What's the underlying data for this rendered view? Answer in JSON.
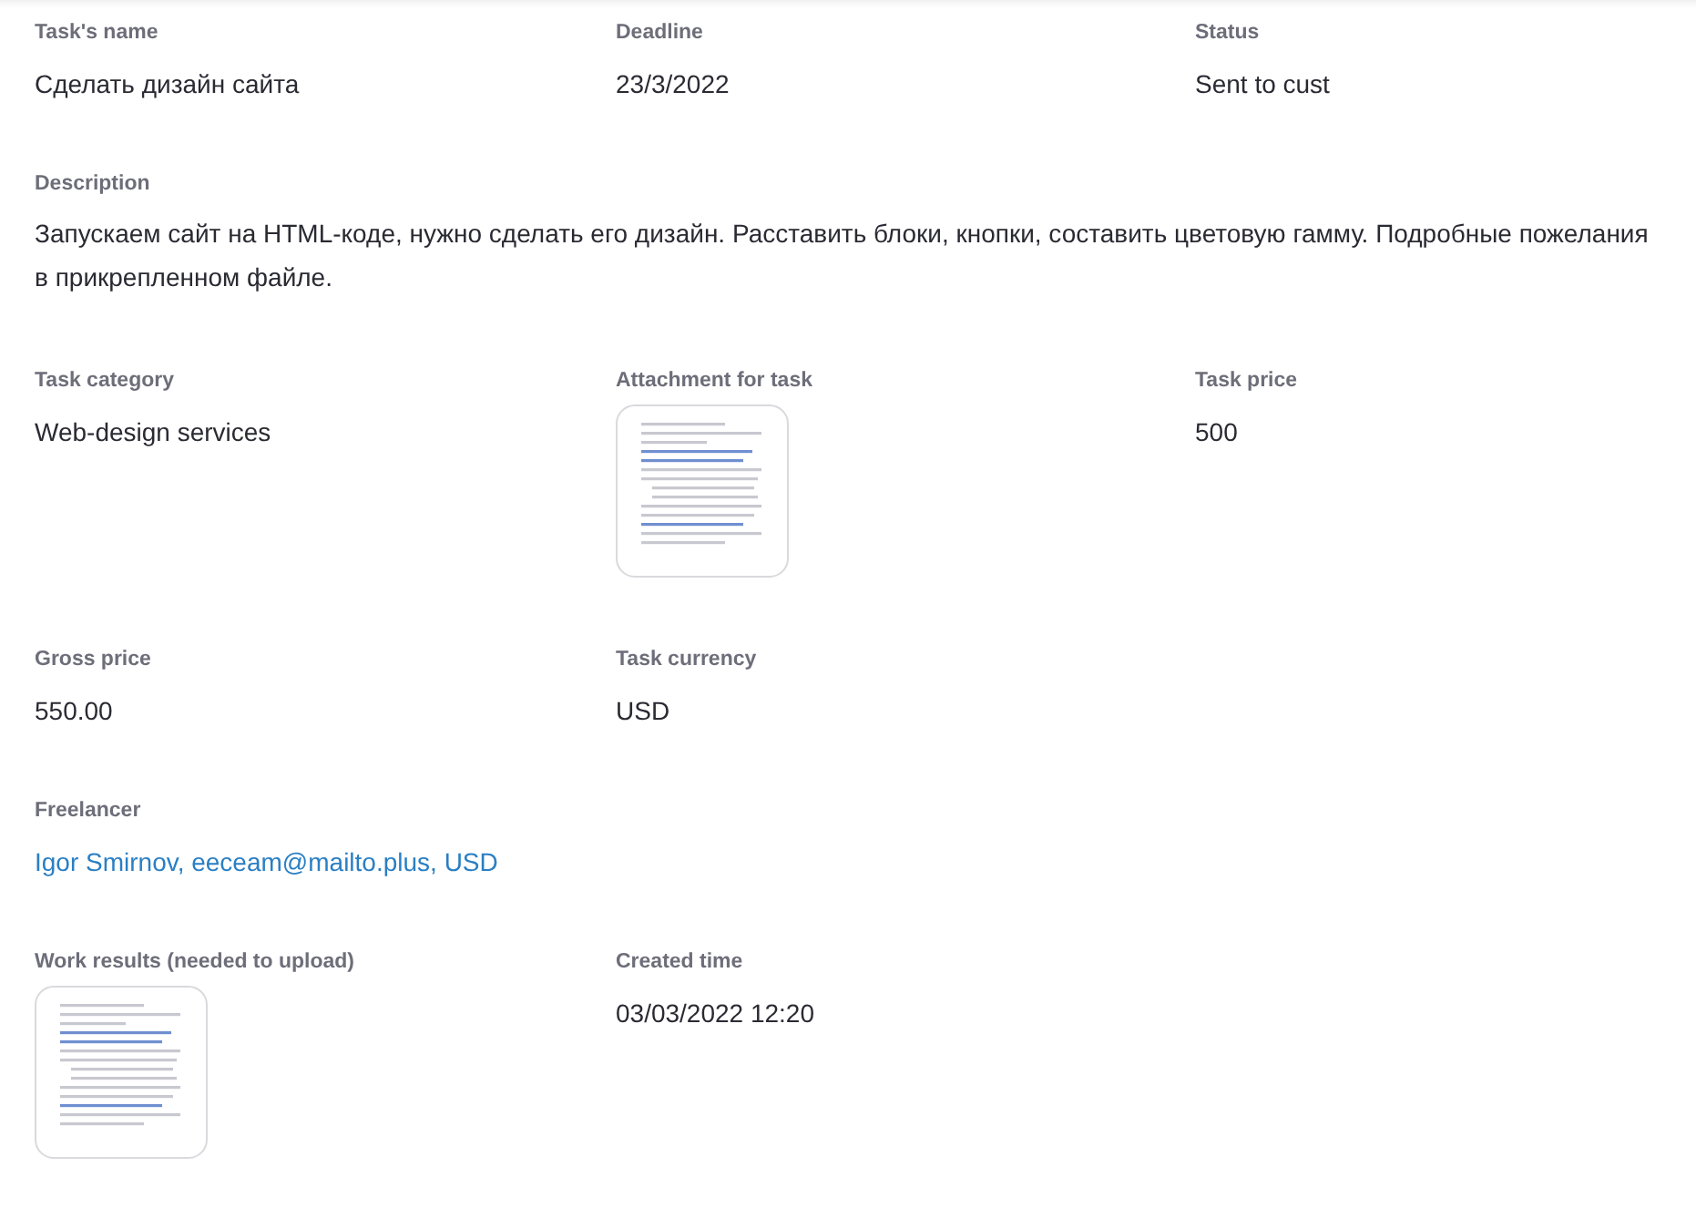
{
  "rows": [
    [
      {
        "kind": "text",
        "label": "Task's name",
        "value": "Сделать дизайн сайта"
      },
      {
        "kind": "text",
        "label": "Deadline",
        "value": "23/3/2022"
      },
      {
        "kind": "text",
        "label": "Status",
        "value": "Sent to cust"
      }
    ],
    [
      {
        "kind": "wide",
        "label": "Description",
        "value": "Запускаем сайт на HTML-коде, нужно сделать его дизайн. Расставить блоки, кнопки, составить цветовую гамму. Подробные пожелания в прикрепленном файле."
      }
    ],
    [
      {
        "kind": "text",
        "label": "Task category",
        "value": "Web-design services"
      },
      {
        "kind": "attachment",
        "label": "Attachment for task"
      },
      {
        "kind": "text",
        "label": "Task price",
        "value": "500"
      }
    ],
    [
      {
        "kind": "text",
        "label": "Gross price",
        "value": "550.00"
      },
      {
        "kind": "text",
        "label": "Task currency",
        "value": "USD"
      }
    ],
    [
      {
        "kind": "link",
        "label": "Freelancer",
        "value": "Igor Smirnov, eeceam@mailto.plus, USD"
      }
    ],
    [
      {
        "kind": "attachment",
        "label": "Work results (needed to upload)"
      },
      {
        "kind": "text",
        "label": "Created time",
        "value": "03/03/2022 12:20"
      }
    ]
  ]
}
